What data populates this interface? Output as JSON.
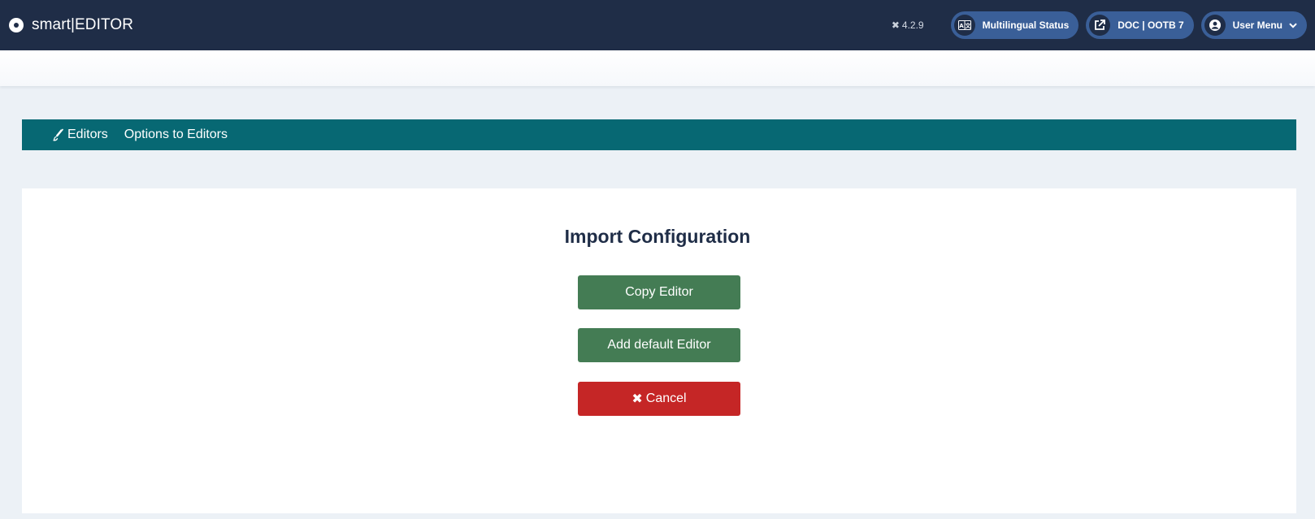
{
  "header": {
    "brand": "smart|EDITOR",
    "version": "4.2.9",
    "multilingual_label": "Multilingual Status",
    "doc_label": "DOC | OOTB 7",
    "user_menu_label": "User Menu"
  },
  "nav": {
    "items": [
      {
        "label": "Editors",
        "icon": "brush-icon"
      },
      {
        "label": "Options to Editors"
      }
    ]
  },
  "main": {
    "title": "Import Configuration",
    "buttons": {
      "copy": "Copy Editor",
      "add_default": "Add default Editor",
      "cancel": "Cancel"
    }
  },
  "colors": {
    "header_bg": "#1f2d47",
    "pill_bg": "#3a5f98",
    "nav_bg": "#076873",
    "green": "#447c54",
    "red": "#c52626",
    "page_bg": "#ecf1f6"
  }
}
